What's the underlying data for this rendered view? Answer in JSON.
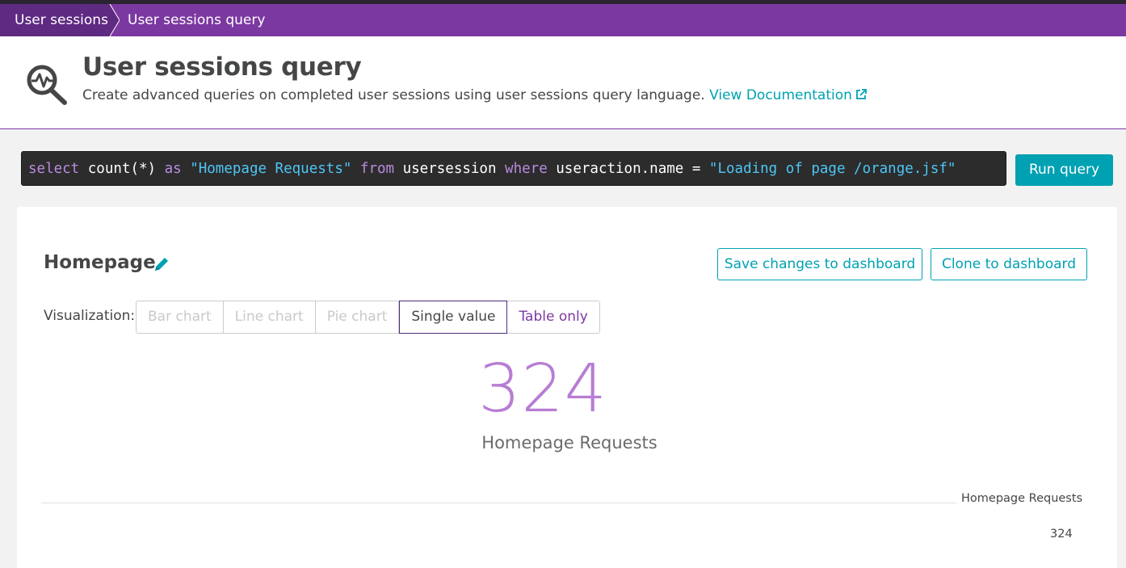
{
  "breadcrumb": {
    "items": [
      "User sessions",
      "User sessions query"
    ]
  },
  "header": {
    "title": "User sessions query",
    "description": "Create advanced queries on completed user sessions using user sessions query language.",
    "doc_link": "View Documentation"
  },
  "query": {
    "tokens": [
      {
        "text": "select ",
        "kind": "kw"
      },
      {
        "text": "count(*) ",
        "kind": "id"
      },
      {
        "text": "as ",
        "kind": "kw"
      },
      {
        "text": "\"Homepage Requests\" ",
        "kind": "str"
      },
      {
        "text": "from ",
        "kind": "kw"
      },
      {
        "text": "usersession ",
        "kind": "id"
      },
      {
        "text": "where ",
        "kind": "kw"
      },
      {
        "text": "useraction.name = ",
        "kind": "id"
      },
      {
        "text": "\"Loading of page /orange.jsf\"",
        "kind": "str"
      }
    ],
    "run_label": "Run query"
  },
  "result": {
    "title": "Homepage",
    "save_label": "Save changes to dashboard",
    "clone_label": "Clone to dashboard",
    "viz_label": "Visualization:",
    "viz_options": [
      "Bar chart",
      "Line chart",
      "Pie chart",
      "Single value",
      "Table only"
    ],
    "viz_selected": "Single value",
    "value": "324",
    "value_label": "Homepage Requests",
    "table": {
      "columns": [
        "Homepage Requests"
      ],
      "rows": [
        [
          "324"
        ]
      ]
    }
  },
  "colors": {
    "brand_purple": "#7c38a1",
    "accent_teal": "#00a1b2",
    "value_purple": "#b77dd4",
    "editor_bg": "#2c2c2c"
  }
}
